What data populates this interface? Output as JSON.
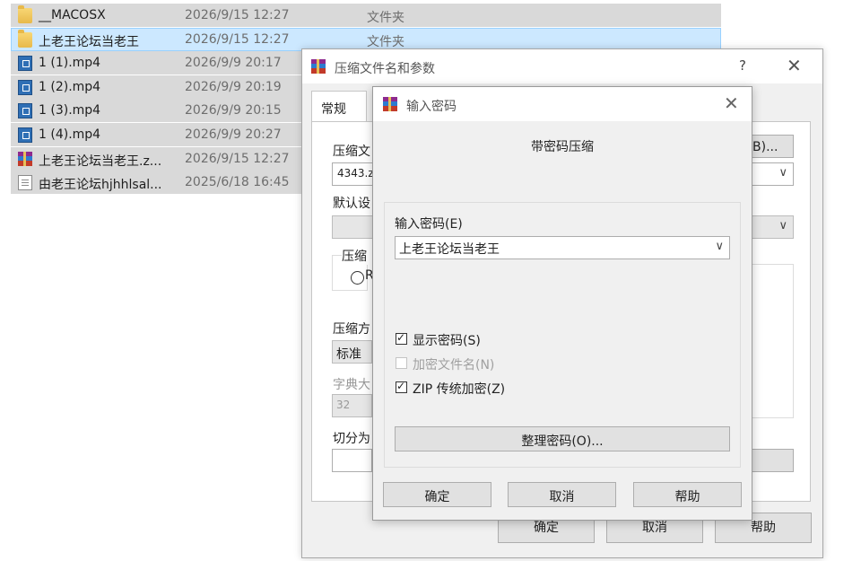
{
  "files": [
    {
      "name": "__MACOSX",
      "date": "2026/9/15 12:27",
      "type": "文件夹",
      "icon": "folder-icon"
    },
    {
      "name": "上老王论坛当老王",
      "date": "2026/9/15 12:27",
      "type": "文件夹",
      "icon": "folder-icon",
      "selected": true
    },
    {
      "name": "1 (1).mp4",
      "date": "2026/9/9 20:17",
      "type": "",
      "icon": "video-file-icon"
    },
    {
      "name": "1 (2).mp4",
      "date": "2026/9/9 20:19",
      "type": "",
      "icon": "video-file-icon"
    },
    {
      "name": "1 (3).mp4",
      "date": "2026/9/9 20:15",
      "type": "",
      "icon": "video-file-icon"
    },
    {
      "name": "1 (4).mp4",
      "date": "2026/9/9 20:27",
      "type": "",
      "icon": "video-file-icon"
    },
    {
      "name": "上老王论坛当老王.z...",
      "date": "2026/9/15 12:27",
      "type": "",
      "icon": "winrar-archive-icon"
    },
    {
      "name": "由老王论坛hjhhlsal...",
      "date": "2025/6/18 16:45",
      "type": "",
      "icon": "text-file-icon"
    }
  ],
  "main_dialog": {
    "title": "压缩文件名和参数",
    "help_glyph": "?",
    "close_glyph": "✕",
    "tab_general": "常规",
    "archive_name_label": "压缩文",
    "archive_name_value": "4343.z",
    "browse_label": "(B)...",
    "default_profile_label": "默认设",
    "format_group_label": "压缩",
    "format_radio_text": "R",
    "method_label": "压缩方",
    "method_value": "标准",
    "dict_label": "字典大",
    "dict_value": "32",
    "split_label": "切分为",
    "ok": "确定",
    "cancel": "取消",
    "help": "帮助"
  },
  "password_dialog": {
    "title": "输入密码",
    "close_glyph": "✕",
    "heading": "带密码压缩",
    "password_label": "输入密码(E)",
    "password_value": "上老王论坛当老王",
    "show_password": {
      "label": "显示密码(S)",
      "checked": true,
      "enabled": true
    },
    "encrypt_names": {
      "label": "加密文件名(N)",
      "checked": false,
      "enabled": false
    },
    "zip_legacy": {
      "label": "ZIP 传统加密(Z)",
      "checked": true,
      "enabled": true
    },
    "organize_button": "整理密码(O)...",
    "ok": "确定",
    "cancel": "取消",
    "help": "帮助"
  },
  "colors": {
    "selected_row": "#cce8ff",
    "row_background": "#d9d9d9",
    "dialog_background": "#f0f0f0",
    "button_face": "#e1e1e1"
  }
}
